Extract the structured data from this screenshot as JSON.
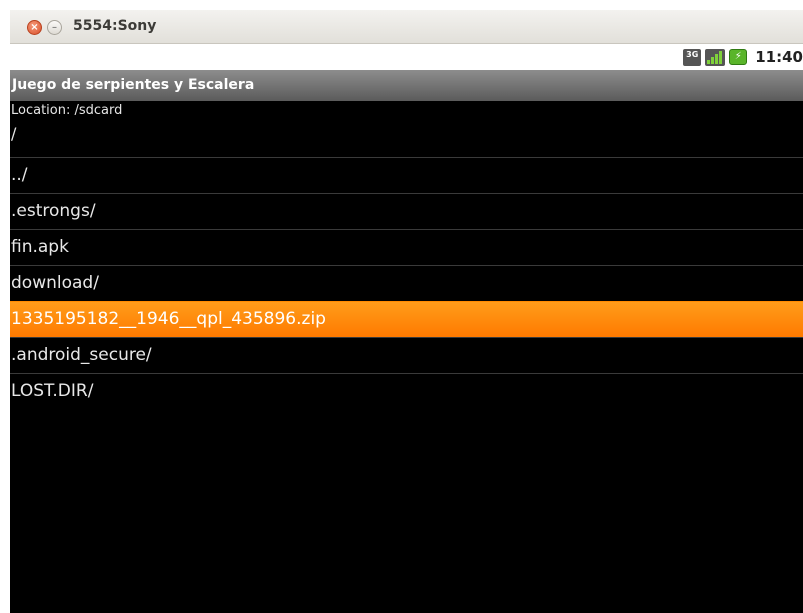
{
  "window": {
    "title": "5554:Sony"
  },
  "status_bar": {
    "network": "3G",
    "time": "11:40"
  },
  "app": {
    "title": "Juego de serpientes y Escalera",
    "location_label": "Location: /sdcard",
    "current_path": "/"
  },
  "files": [
    {
      "name": "../"
    },
    {
      "name": ".estrongs/"
    },
    {
      "name": "fin.apk"
    },
    {
      "name": "download/"
    },
    {
      "name": "1335195182__1946__qpl_435896.zip"
    },
    {
      "name": ".android_secure/"
    },
    {
      "name": "LOST.DIR/"
    }
  ],
  "selected_file": "1335195182__1946__qpl_435896.zip",
  "colors": {
    "highlight": "#ff8a00",
    "background": "#000000",
    "titlebar": "#6e6e6e"
  }
}
